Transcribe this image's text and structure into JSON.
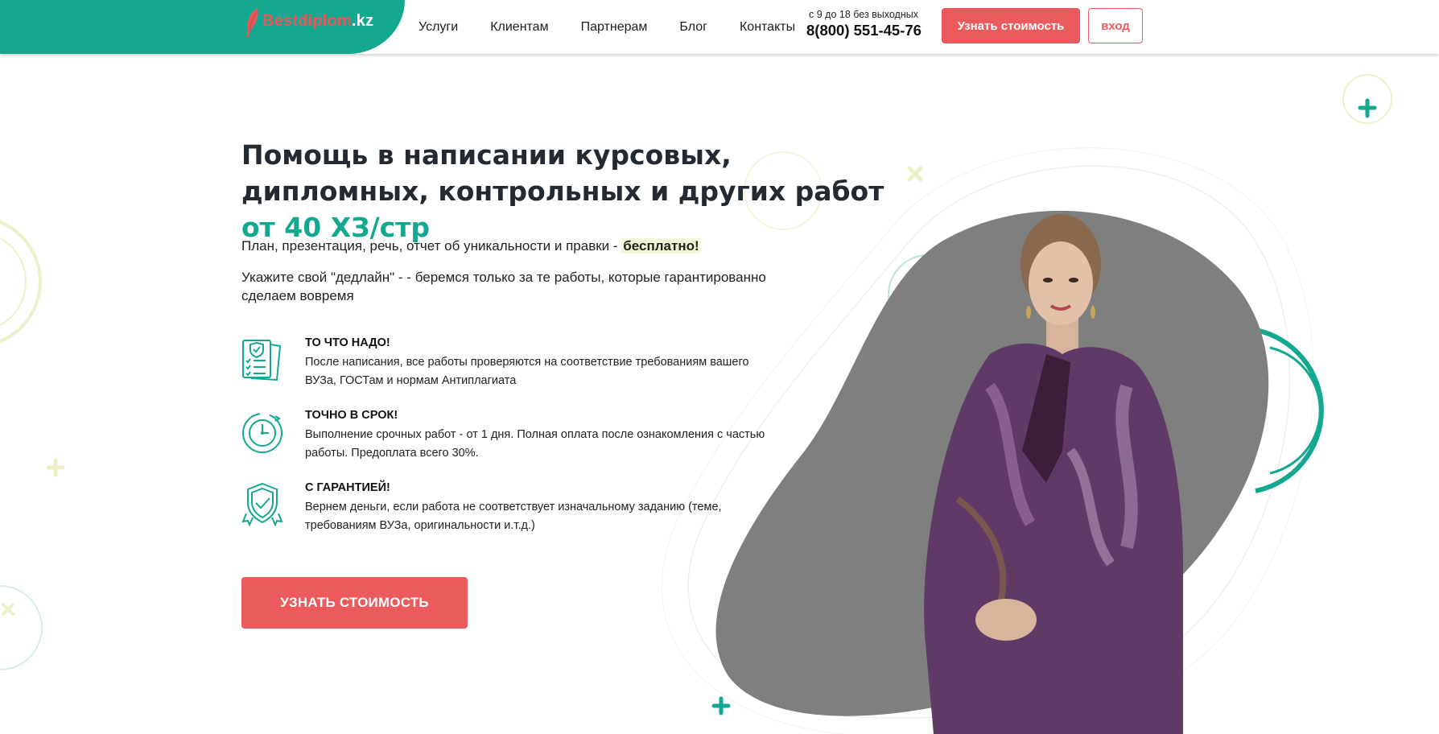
{
  "header": {
    "logo_text": "Bestdiplom",
    "logo_suffix": ".kz",
    "nav": [
      "Услуги",
      "Клиентам",
      "Партнерам",
      "Блог",
      "Контакты"
    ],
    "phone_hours": "с 9 до 18 без выходных",
    "phone": "8(800) 551-45-76",
    "price_button": "Узнать стоимость",
    "login_button": "вход"
  },
  "hero": {
    "title_main": "Помощь в написании курсовых, дипломных, контрольных и других работ",
    "title_accent": "от 40 ХЗ/стр",
    "subtitle_prefix": "План, презентация, речь, отчет об уникальности и правки - ",
    "subtitle_bold": "бесплатно!",
    "deadline": "Укажите свой \"дедлайн\" - - беремся только за те работы, которые гарантированно сделаем вовремя",
    "cta": "УЗНАТЬ СТОИМОСТЬ"
  },
  "features": [
    {
      "icon": "document-shield-icon",
      "title": "ТО ЧТО НАДО!",
      "text": "После написания, все работы проверяются на соответствие требованиям вашего ВУЗа, ГОСТам и нормам Антиплагиата"
    },
    {
      "icon": "clock-icon",
      "title": "ТОЧНО В СРОК!",
      "text": "Выполнение срочных работ - от 1 дня. Полная оплата после ознакомления с частью работы. Предоплата всего 30%."
    },
    {
      "icon": "guarantee-shield-icon",
      "title": "С ГАРАНТИЕЙ!",
      "text": "Вернем деньги, если работа не соответствует изначальному заданию (теме, требованиям ВУЗа, оригинальности и.т.д.)"
    }
  ],
  "colors": {
    "brand_teal": "#13a88f",
    "brand_red": "#eb5a5c",
    "decor_yellow": "#eef0c8"
  }
}
